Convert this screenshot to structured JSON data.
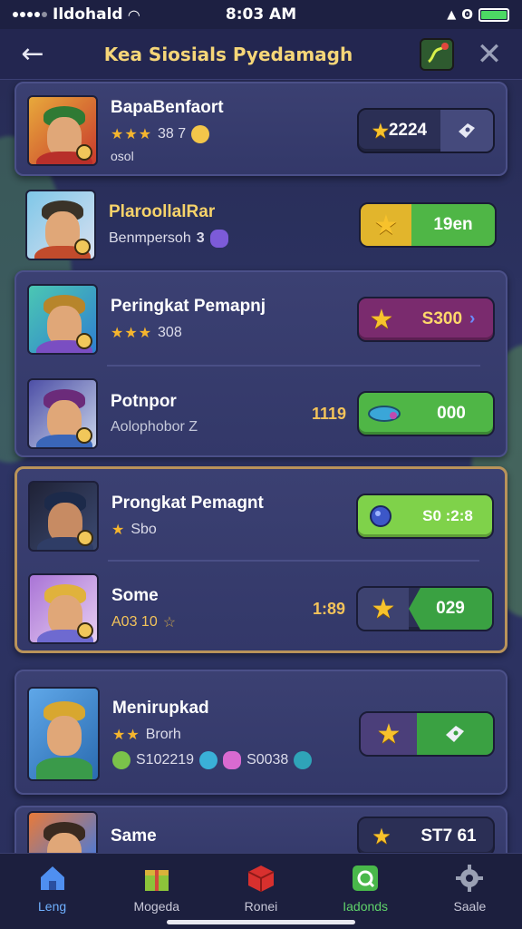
{
  "status_bar": {
    "carrier": "Ildohald",
    "time": "8:03 AM",
    "icons": [
      "signal-dots",
      "wifi-icon",
      "location-icon",
      "bluetooth-icon",
      "battery-icon"
    ]
  },
  "header": {
    "title": "Kea Siosials Pyedamagh",
    "back_icon": "arrow-left-icon",
    "map_icon": "map-icon",
    "close_icon": "close-icon"
  },
  "rows": [
    {
      "name": "BapaBenfaort",
      "stars": "★★★",
      "sub": "38 7",
      "extra": "osol",
      "pill_value": "2224",
      "pill_style": "dark"
    },
    {
      "name": "PlaroollalRar",
      "sub": "Benmpersoh",
      "extra_icon": "3",
      "pill_value": "19en",
      "pill_style": "yellow-green"
    },
    {
      "name": "Peringkat Pemapnj",
      "stars": "★★★",
      "sub": "308",
      "pill_value": "S300",
      "pill_style": "purple"
    },
    {
      "name": "Potnpor",
      "sub": "Aolophobor Z",
      "side_value": "1119",
      "pill_value": "000",
      "pill_style": "green-gem"
    },
    {
      "name": "Prongkat Pemagnt",
      "stars": "★",
      "sub": "Sbo",
      "pill_value": "S0 :2:8",
      "pill_style": "lime"
    },
    {
      "name": "Some",
      "sub": "A03 10",
      "side_value": "1:89",
      "pill_value": "029",
      "pill_style": "dark-green"
    },
    {
      "name": "Menirupkad",
      "stars": "★★",
      "sub": "Brorh",
      "chips": [
        "S102219",
        "S0038"
      ],
      "pill_style": "dark-ticket"
    },
    {
      "name": "Same",
      "pill_value": "ST7 61",
      "pill_style": "dark"
    }
  ],
  "tabs": [
    {
      "label": "Leng",
      "icon": "home-icon"
    },
    {
      "label": "Mogeda",
      "icon": "gift-icon"
    },
    {
      "label": "Ronei",
      "icon": "cube-icon"
    },
    {
      "label": "Iadonds",
      "icon": "leaderboard-icon"
    },
    {
      "label": "Saale",
      "icon": "gear-icon"
    }
  ],
  "colors": {
    "title_gold": "#f6d678",
    "star": "#f7c22c",
    "pill_green": "#4fb646",
    "pill_purple": "#7a2b6e",
    "active_tab": "#6fb0ff"
  }
}
